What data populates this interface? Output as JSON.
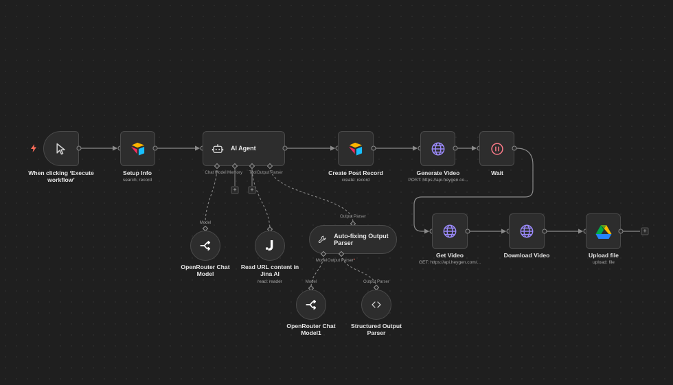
{
  "colors": {
    "canvas": "#1f1f1f",
    "node_bg": "#2d2d2d",
    "edge": "#8a8a8a",
    "trigger_bolt": "#ff6d5a",
    "globe": "#9b8afb",
    "wait": "#ff7b8a"
  },
  "nodes": {
    "trigger": {
      "label": "When clicking ‘Execute workflow’",
      "icon": "cursor-pointer-icon"
    },
    "setup_info": {
      "label": "Setup Info",
      "subtitle": "search: record",
      "icon": "airtable-icon"
    },
    "ai_agent": {
      "label": "AI Agent",
      "icon": "robot-icon",
      "ports": [
        "Chat Model",
        "Memory",
        "Tool",
        "Output Parser"
      ]
    },
    "create_post": {
      "label": "Create Post Record",
      "subtitle": "create: record",
      "icon": "airtable-icon"
    },
    "generate_video": {
      "label": "Generate Video",
      "subtitle": "POST: https://api.heygen.co...",
      "icon": "globe-icon"
    },
    "wait": {
      "label": "Wait",
      "icon": "pause-icon"
    },
    "get_video": {
      "label": "Get Video",
      "subtitle": "GET: https://api.heygen.com/...",
      "icon": "globe-icon"
    },
    "download_video": {
      "label": "Download Video",
      "icon": "globe-icon"
    },
    "upload_file": {
      "label": "Upload file",
      "subtitle": "upload: file",
      "icon": "google-drive-icon"
    },
    "openrouter": {
      "label": "OpenRouter Chat Model",
      "port": "Model",
      "icon": "openrouter-icon"
    },
    "jina": {
      "label": "Read URL content in Jina AI",
      "subtitle": "read: reader",
      "icon": "jina-icon"
    },
    "autofix": {
      "label": "Auto-fixing Output Parser",
      "port_top": "Output Parser",
      "ports": [
        "Model",
        "Output Parser"
      ],
      "required_mark": "*",
      "icon": "wrench-icon"
    },
    "openrouter1": {
      "label": "OpenRouter Chat Model1",
      "port": "Model",
      "icon": "openrouter-icon"
    },
    "structured": {
      "label": "Structured Output Parser",
      "port": "Output Parser",
      "icon": "code-brackets-icon"
    }
  },
  "add_node_symbol": "+"
}
